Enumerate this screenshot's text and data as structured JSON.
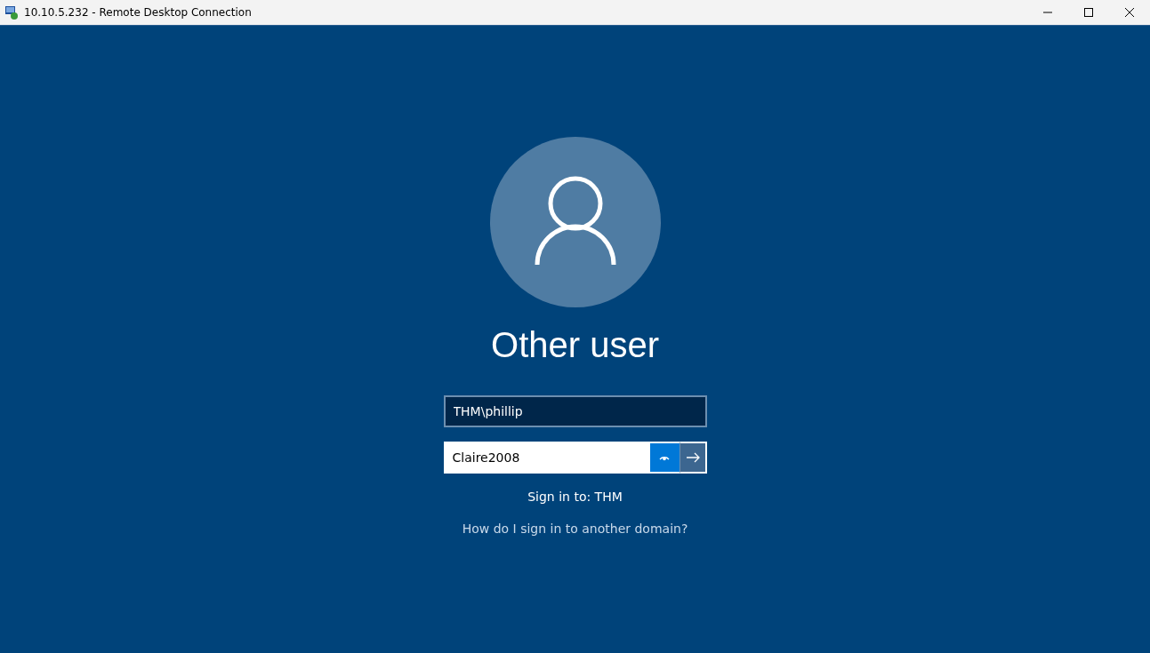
{
  "window": {
    "title": "10.10.5.232 - Remote Desktop Connection"
  },
  "login": {
    "user_name": "Other user",
    "username_field": {
      "value": "THM\\phillip"
    },
    "password_field": {
      "value": "Claire2008"
    },
    "sign_in_to": "Sign in to: THM",
    "domain_link": "How do I sign in to another domain?"
  }
}
